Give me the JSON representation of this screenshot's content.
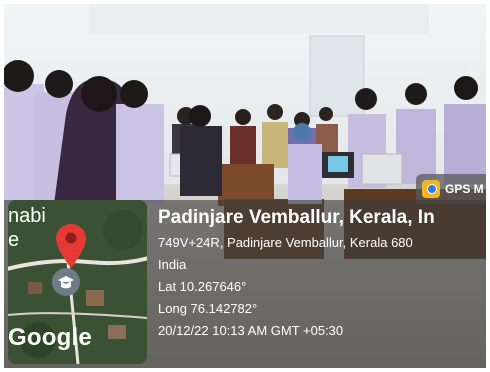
{
  "badge": {
    "label": "GPS M"
  },
  "map": {
    "top_left_label": "nabi\ne",
    "google_label": "Google"
  },
  "location": {
    "title": "Padinjare Vemballur, Kerala, In",
    "address_line1": "749V+24R, Padinjare Vemballur, Kerala 680",
    "address_line2": "India",
    "lat": "Lat 10.267646°",
    "long": "Long 76.142782°",
    "datetime": "20/12/22 10:13 AM GMT +05:30"
  },
  "colors": {
    "pin": "#e53935",
    "overlay": "#3c3c3c",
    "badge_icon": "#f3b32a"
  }
}
